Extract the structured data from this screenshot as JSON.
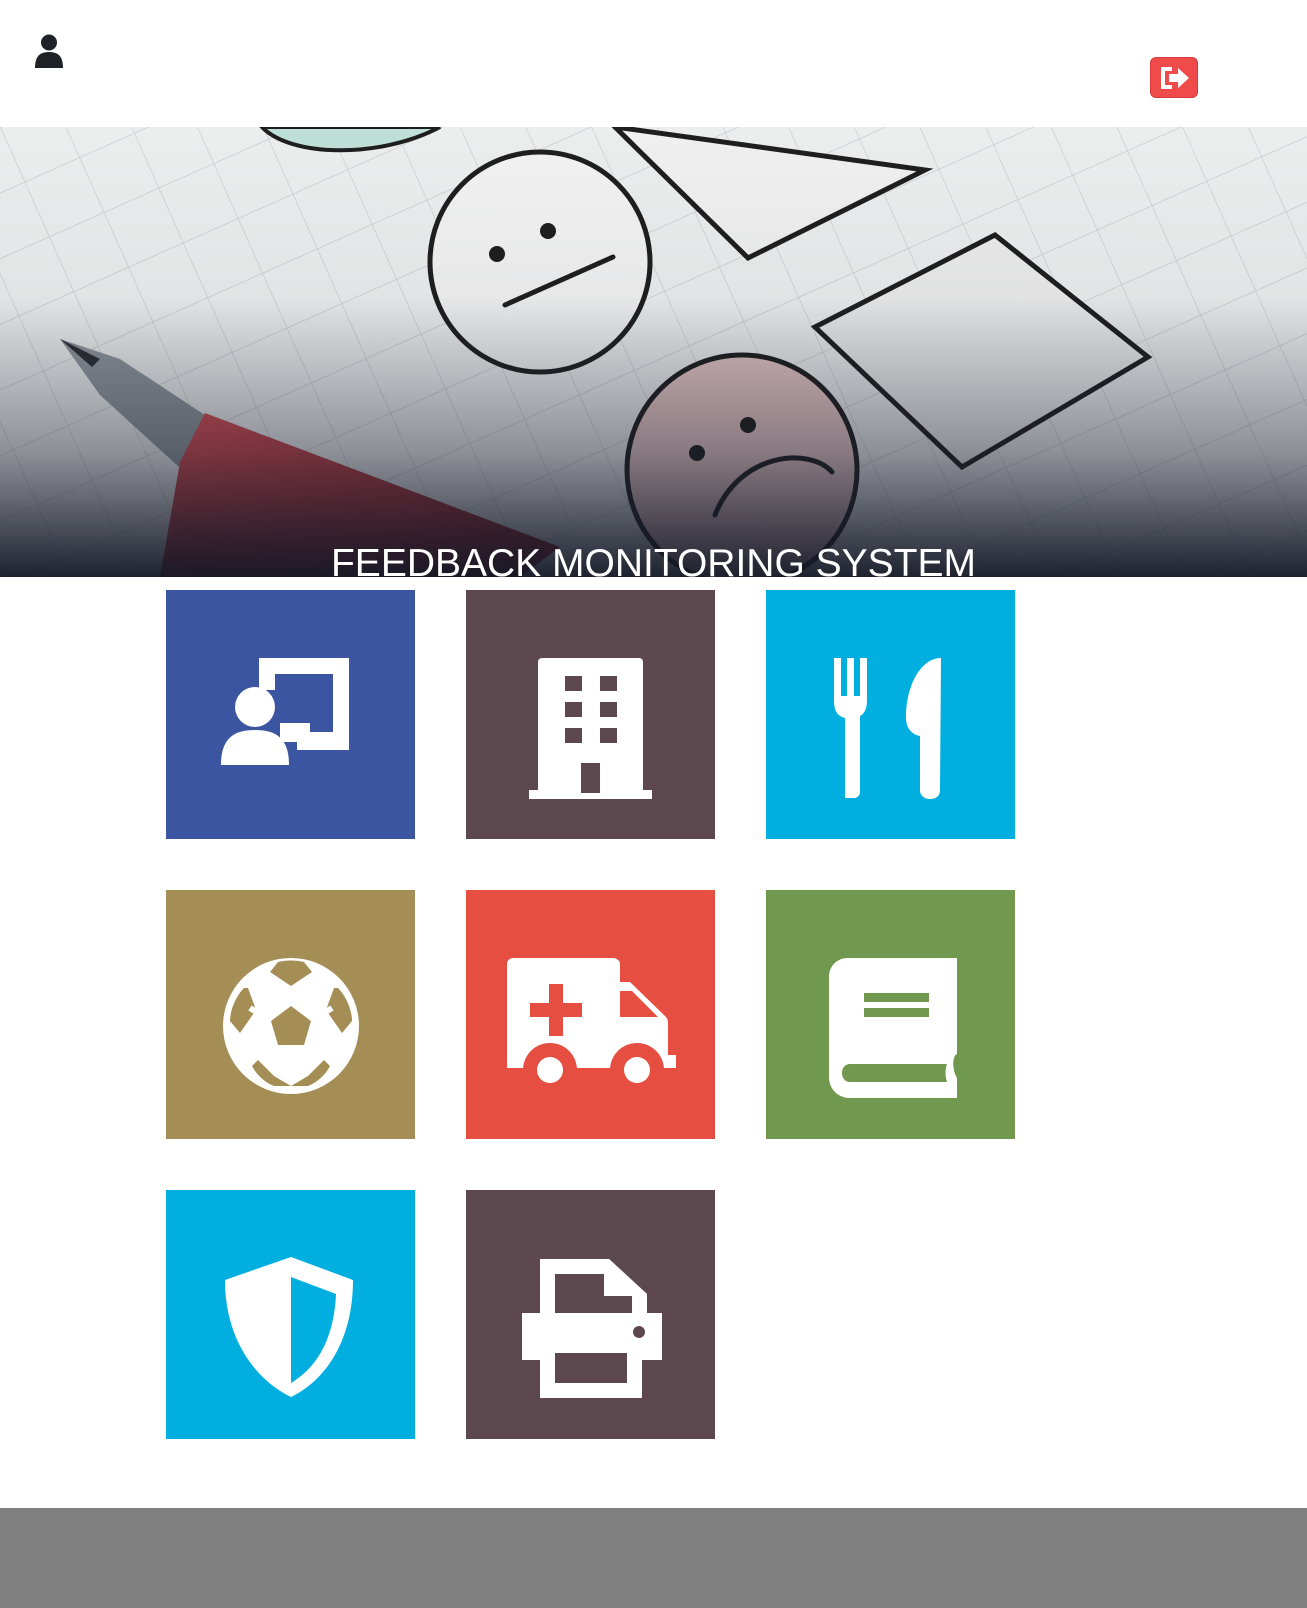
{
  "header": {
    "user_icon": "user-icon",
    "logout_icon": "sign-out-icon",
    "logout_color": "#f04b4b"
  },
  "hero": {
    "title": "FEEDBACK MONITORING SYSTEM",
    "image": "feedback-emoji-checklist-photo"
  },
  "tiles": [
    {
      "icon": "chalkboard-teacher-icon",
      "color": "#3b55a0"
    },
    {
      "icon": "building-icon",
      "color": "#5e4850"
    },
    {
      "icon": "utensils-icon",
      "color": "#00afe0"
    },
    {
      "icon": "futbol-icon",
      "color": "#a58e56"
    },
    {
      "icon": "ambulance-icon",
      "color": "#e64e41"
    },
    {
      "icon": "book-icon",
      "color": "#71984f"
    },
    {
      "icon": "shield-icon",
      "color": "#00afe0"
    },
    {
      "icon": "print-icon",
      "color": "#5e4850"
    }
  ],
  "footer": {
    "color": "#808080"
  }
}
